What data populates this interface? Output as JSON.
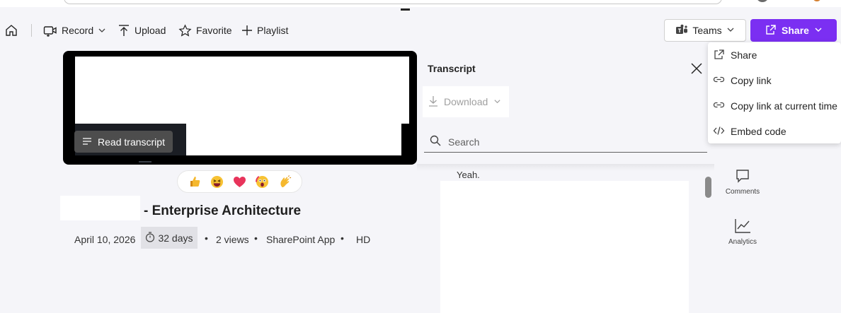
{
  "toolbar": {
    "record": "Record",
    "upload": "Upload",
    "favorite": "Favorite",
    "playlist": "Playlist",
    "teams": "Teams",
    "share": "Share"
  },
  "share_menu": {
    "items": [
      "Share",
      "Copy link",
      "Copy link at current time",
      "Embed code"
    ]
  },
  "video": {
    "read_transcript": "Read transcript",
    "reactions": [
      "thumbs-up",
      "laughing",
      "heart",
      "surprised",
      "clapping"
    ]
  },
  "details": {
    "title": "- Enterprise Architecture",
    "date": "April 10, 2026",
    "retention": "32 days",
    "views": "2 views",
    "source": "SharePoint App",
    "quality": "HD",
    "bullet": "•"
  },
  "transcript": {
    "title": "Transcript",
    "download": "Download",
    "search_placeholder": "Search",
    "partial_line": "Yeah."
  },
  "rail": {
    "comments": "Comments",
    "analytics": "Analytics"
  },
  "colors": {
    "accent": "#7b2ff2",
    "background": "#f5f5f9"
  }
}
